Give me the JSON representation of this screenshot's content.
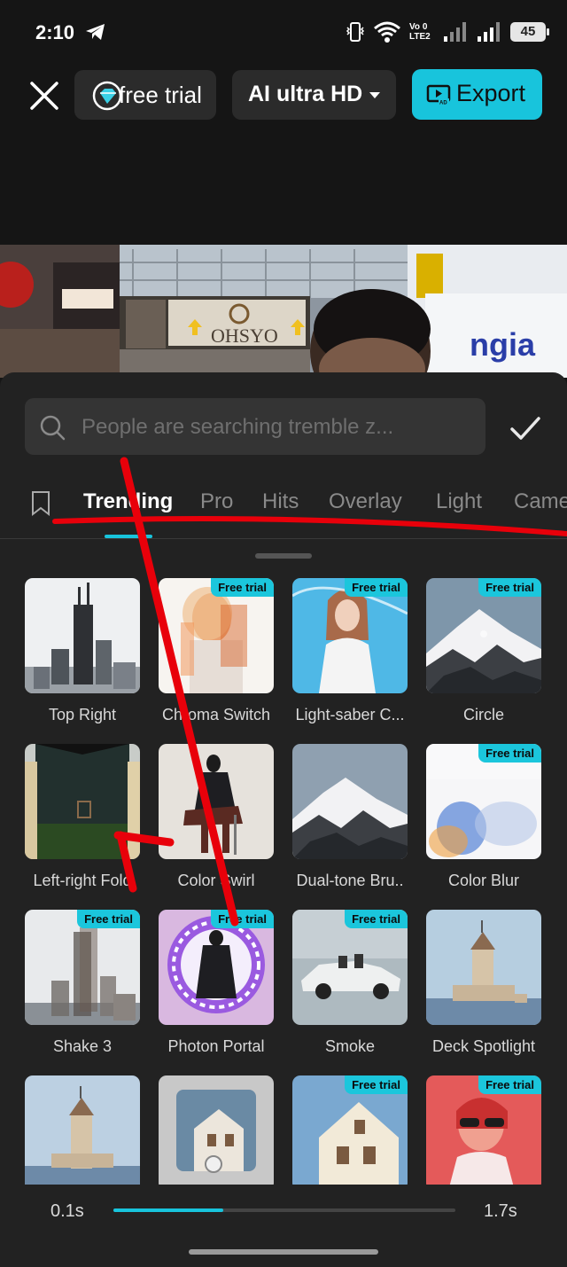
{
  "status_bar": {
    "time": "2:10",
    "network_label": "Vo 0\nLTE2",
    "battery": "45",
    "icons": [
      "telegram-icon",
      "vibrate-icon",
      "wifi-icon",
      "signal-icon",
      "battery-icon"
    ]
  },
  "toolbar": {
    "free_trial_label": "free trial",
    "quality_label": "AI ultra HD",
    "export_label": "Export"
  },
  "search": {
    "placeholder": "People are searching tremble z..."
  },
  "tabs": [
    {
      "label": "Trending",
      "active": true
    },
    {
      "label": "Pro"
    },
    {
      "label": "Hits"
    },
    {
      "label": "Overlay"
    },
    {
      "label": "Light"
    },
    {
      "label": "Came"
    }
  ],
  "effects": [
    {
      "name": "Top Right",
      "badge": ""
    },
    {
      "name": "Chroma Switch",
      "badge": "Free trial"
    },
    {
      "name": "Light-saber C...",
      "badge": "Free trial"
    },
    {
      "name": "Circle",
      "badge": "Free trial"
    },
    {
      "name": "Left-right Fold",
      "badge": ""
    },
    {
      "name": "Color Swirl",
      "badge": ""
    },
    {
      "name": "Dual-tone Bru..",
      "badge": ""
    },
    {
      "name": "Color Blur",
      "badge": "Free trial"
    },
    {
      "name": "Shake 3",
      "badge": "Free trial"
    },
    {
      "name": "Photon Portal",
      "badge": "Free trial"
    },
    {
      "name": "Smoke",
      "badge": "Free trial"
    },
    {
      "name": "Deck Spotlight",
      "badge": ""
    },
    {
      "name": "",
      "badge": ""
    },
    {
      "name": "",
      "badge": ""
    },
    {
      "name": "",
      "badge": "Free trial"
    },
    {
      "name": "",
      "badge": "Free trial"
    }
  ],
  "duration": {
    "start": "0.1s",
    "end": "1.7s",
    "fill_fraction": 0.32
  },
  "colors": {
    "accent": "#18c4dc",
    "annotation": "#e8000a"
  }
}
